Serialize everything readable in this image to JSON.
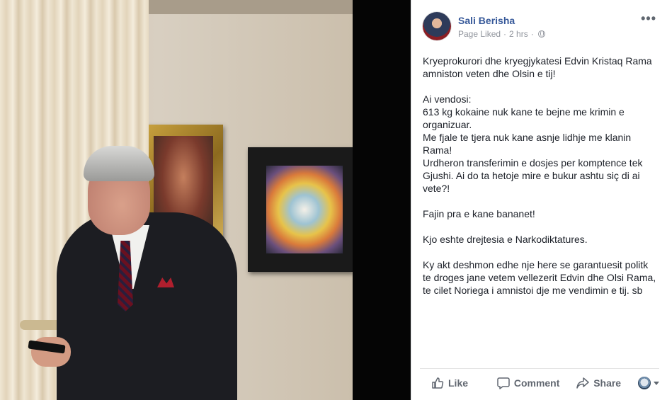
{
  "post": {
    "author": "Sali Berisha",
    "page_status": "Page Liked",
    "separator": "·",
    "time": "2 hrs",
    "privacy_icon": "globe-icon",
    "menu_icon": "more-options-icon",
    "paragraphs": [
      "Kryeprokurori dhe kryegjykatesi Edvin Kristaq Rama amniston veten dhe Olsin e tij!",
      "Ai vendosi:\n613 kg kokaine nuk kane te bejne me krimin e organizuar.\nMe fjale te tjera nuk kane asnje lidhje me klanin Rama!\nUrdheron transferimin e dosjes per komptence tek Gjushi. Ai do ta hetoje mire e bukur ashtu siç di ai vete?!",
      "Fajin pra e kane bananet!",
      "Kjo eshte drejtesia e Narkodiktatures.",
      "Ky akt deshmon edhe nje here se garantuesit politk te droges jane vetem vellezerit Edvin dhe Olsi Rama, te cilet Noriega i amnistoi dje me vendimin e tij. sb"
    ]
  },
  "actions": {
    "like": "Like",
    "comment": "Comment",
    "share": "Share"
  }
}
